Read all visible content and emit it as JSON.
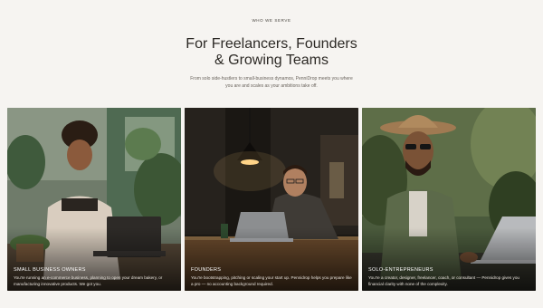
{
  "section": {
    "eyebrow": "WHO WE SERVE",
    "headline_line1": "For Freelancers, Founders",
    "headline_line2": "& Growing Teams",
    "subtitle": "From solo side-hustlers to small-business dynamos, PenniDrop meets you where you are and scales as your ambitions take off."
  },
  "cards": [
    {
      "title": "SMALL BUSINESS OWNERS",
      "description": "You're running an e-commerce business, planning to open your dream bakery, or manufacturing innovative products. We got you.",
      "image": "woman-working-on-laptop-in-plant-filled-shop"
    },
    {
      "title": "FOUNDERS",
      "description": "You're bootstrapping, pitching or scaling your start up. Pennidrop helps you prepare like a pro — no accounting background required.",
      "image": "smiling-man-with-laptop-under-pendant-lamp"
    },
    {
      "title": "SOLO-ENTREPRENEURS",
      "description": "You're a creator, designer, freelancer, coach, or consultant — Pennidrop gives you financial clarity with none of the complexity.",
      "image": "man-in-hat-and-sunglasses-using-laptop"
    }
  ]
}
